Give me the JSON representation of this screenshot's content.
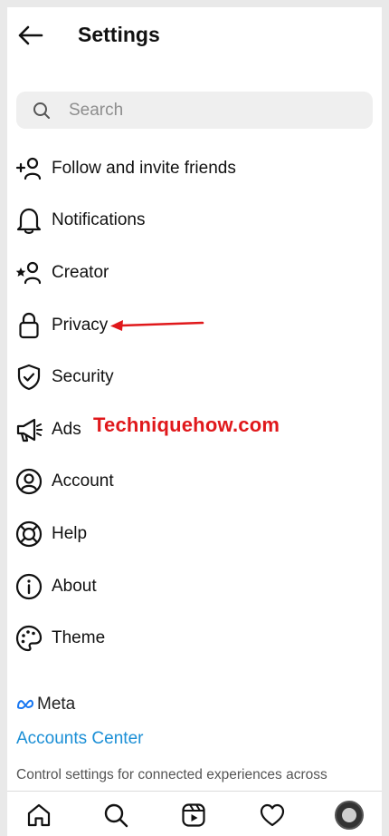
{
  "header": {
    "title": "Settings",
    "back_icon": "arrow-left-icon"
  },
  "search": {
    "placeholder": "Search",
    "icon": "search-icon"
  },
  "menu": {
    "items": [
      {
        "label": "Follow and invite friends",
        "icon": "add-user-icon"
      },
      {
        "label": "Notifications",
        "icon": "bell-icon"
      },
      {
        "label": "Creator",
        "icon": "star-user-icon"
      },
      {
        "label": "Privacy",
        "icon": "lock-icon"
      },
      {
        "label": "Security",
        "icon": "shield-check-icon"
      },
      {
        "label": "Ads",
        "icon": "megaphone-icon"
      },
      {
        "label": "Account",
        "icon": "user-circle-icon"
      },
      {
        "label": "Help",
        "icon": "lifebuoy-icon"
      },
      {
        "label": "About",
        "icon": "info-icon"
      },
      {
        "label": "Theme",
        "icon": "palette-icon"
      }
    ]
  },
  "annotation": {
    "watermark": "Techniquehow.com",
    "arrow_color": "#e0181b"
  },
  "meta_section": {
    "brand": "Meta",
    "accounts_center": "Accounts Center",
    "description": "Control settings for connected experiences across"
  },
  "bottom_nav": {
    "items": [
      "home-icon",
      "search-icon",
      "reels-icon",
      "heart-icon",
      "profile-avatar"
    ]
  },
  "colors": {
    "link": "#1b8fd6",
    "watermark": "#e0181b",
    "search_bg": "#efefef"
  }
}
